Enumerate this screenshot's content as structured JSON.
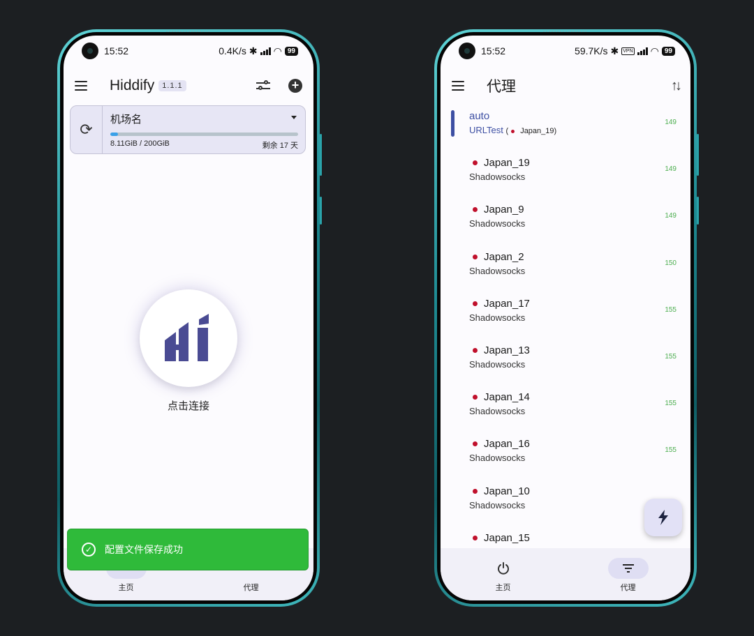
{
  "left_phone": {
    "status": {
      "time": "15:52",
      "speed": "0.4K/s",
      "battery": "99"
    },
    "appbar": {
      "title": "Hiddify",
      "version": "1.1.1"
    },
    "profile": {
      "name": "机场名",
      "usage": "8.11GiB / 200GiB",
      "remaining": "剩余 17 天",
      "usage_fraction": 0.04
    },
    "connect_label": "点击连接",
    "toast": "配置文件保存成功",
    "nav": {
      "home": "主页",
      "proxy": "代理"
    }
  },
  "right_phone": {
    "status": {
      "time": "15:52",
      "speed": "59.7K/s",
      "vpn": "VPN",
      "battery": "99"
    },
    "appbar": {
      "title": "代理"
    },
    "auto": {
      "name": "auto",
      "type": "URLTest",
      "selected": "Japan_19",
      "latency": "149"
    },
    "proxies": [
      {
        "name": "Japan_19",
        "type": "Shadowsocks",
        "latency": "149"
      },
      {
        "name": "Japan_9",
        "type": "Shadowsocks",
        "latency": "149"
      },
      {
        "name": "Japan_2",
        "type": "Shadowsocks",
        "latency": "150"
      },
      {
        "name": "Japan_17",
        "type": "Shadowsocks",
        "latency": "155"
      },
      {
        "name": "Japan_13",
        "type": "Shadowsocks",
        "latency": "155"
      },
      {
        "name": "Japan_14",
        "type": "Shadowsocks",
        "latency": "155"
      },
      {
        "name": "Japan_16",
        "type": "Shadowsocks",
        "latency": "155"
      },
      {
        "name": "Japan_10",
        "type": "Shadowsocks",
        "latency": ""
      },
      {
        "name": "Japan_15",
        "type": "",
        "latency": ""
      }
    ],
    "nav": {
      "home": "主页",
      "proxy": "代理"
    }
  },
  "colors": {
    "accent": "#3d4fa3",
    "success": "#2fba3a",
    "latency": "#4cae4f",
    "logo": "#4a4b93"
  }
}
